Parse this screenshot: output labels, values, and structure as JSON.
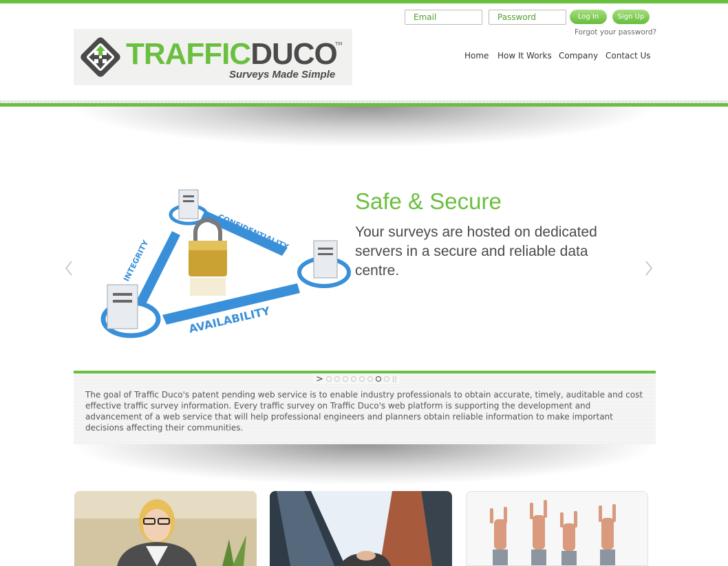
{
  "header": {
    "login": {
      "email_placeholder": "Email",
      "password_placeholder": "Password",
      "login_label": "Log In",
      "signup_label": "Sign Up",
      "forgot_label": "Forgot your password?"
    },
    "logo": {
      "word_part1": "TRAFFIC",
      "word_part2": "DUCO",
      "trademark": "TM",
      "tagline": "Surveys Made Simple"
    },
    "nav": [
      "Home",
      "How It Works",
      "Company",
      "Contact Us"
    ]
  },
  "slider": {
    "title": "Safe & Secure",
    "text": "Your surveys are hosted on dedicated servers in a secure and reliable data centre.",
    "image_labels": [
      "INTEGRITY",
      "CONFIDENTIALITY",
      "AVAILABILITY"
    ],
    "slide_count": 9,
    "active_slide": 7
  },
  "caption": {
    "text": "The goal of Traffic Duco's patent pending web service is to enable industry professionals to obtain accurate, timely, auditable and cost effective traffic survey information. Every traffic survey on Traffic Duco's web platform is supporting the development and advancement of a web service that will help professional engineers and planners obtain reliable information to make important decisions affecting their communities."
  },
  "colors": {
    "brand_green": "#6abf3f",
    "dark_grey": "#4a4a4a",
    "accent_blue": "#3a8fd9"
  }
}
